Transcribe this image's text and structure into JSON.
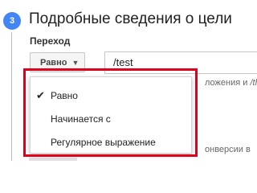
{
  "step": {
    "number": "3",
    "title": "Подробные сведения о цели"
  },
  "destination": {
    "label": "Переход",
    "match_type": "Равно",
    "url_value": "/test",
    "hint_line1": "ложения и",
    "hint_line1_italic": "/th",
    "hint_line2": "онверсии в"
  },
  "dropdown": {
    "check_icon": "✔",
    "options": [
      {
        "label": "Равно",
        "selected": true
      },
      {
        "label": "Начинается с",
        "selected": false
      },
      {
        "label": "Регулярное выражение",
        "selected": false
      }
    ]
  },
  "colors": {
    "accent": "#4285f4",
    "highlight": "#e0001a"
  }
}
